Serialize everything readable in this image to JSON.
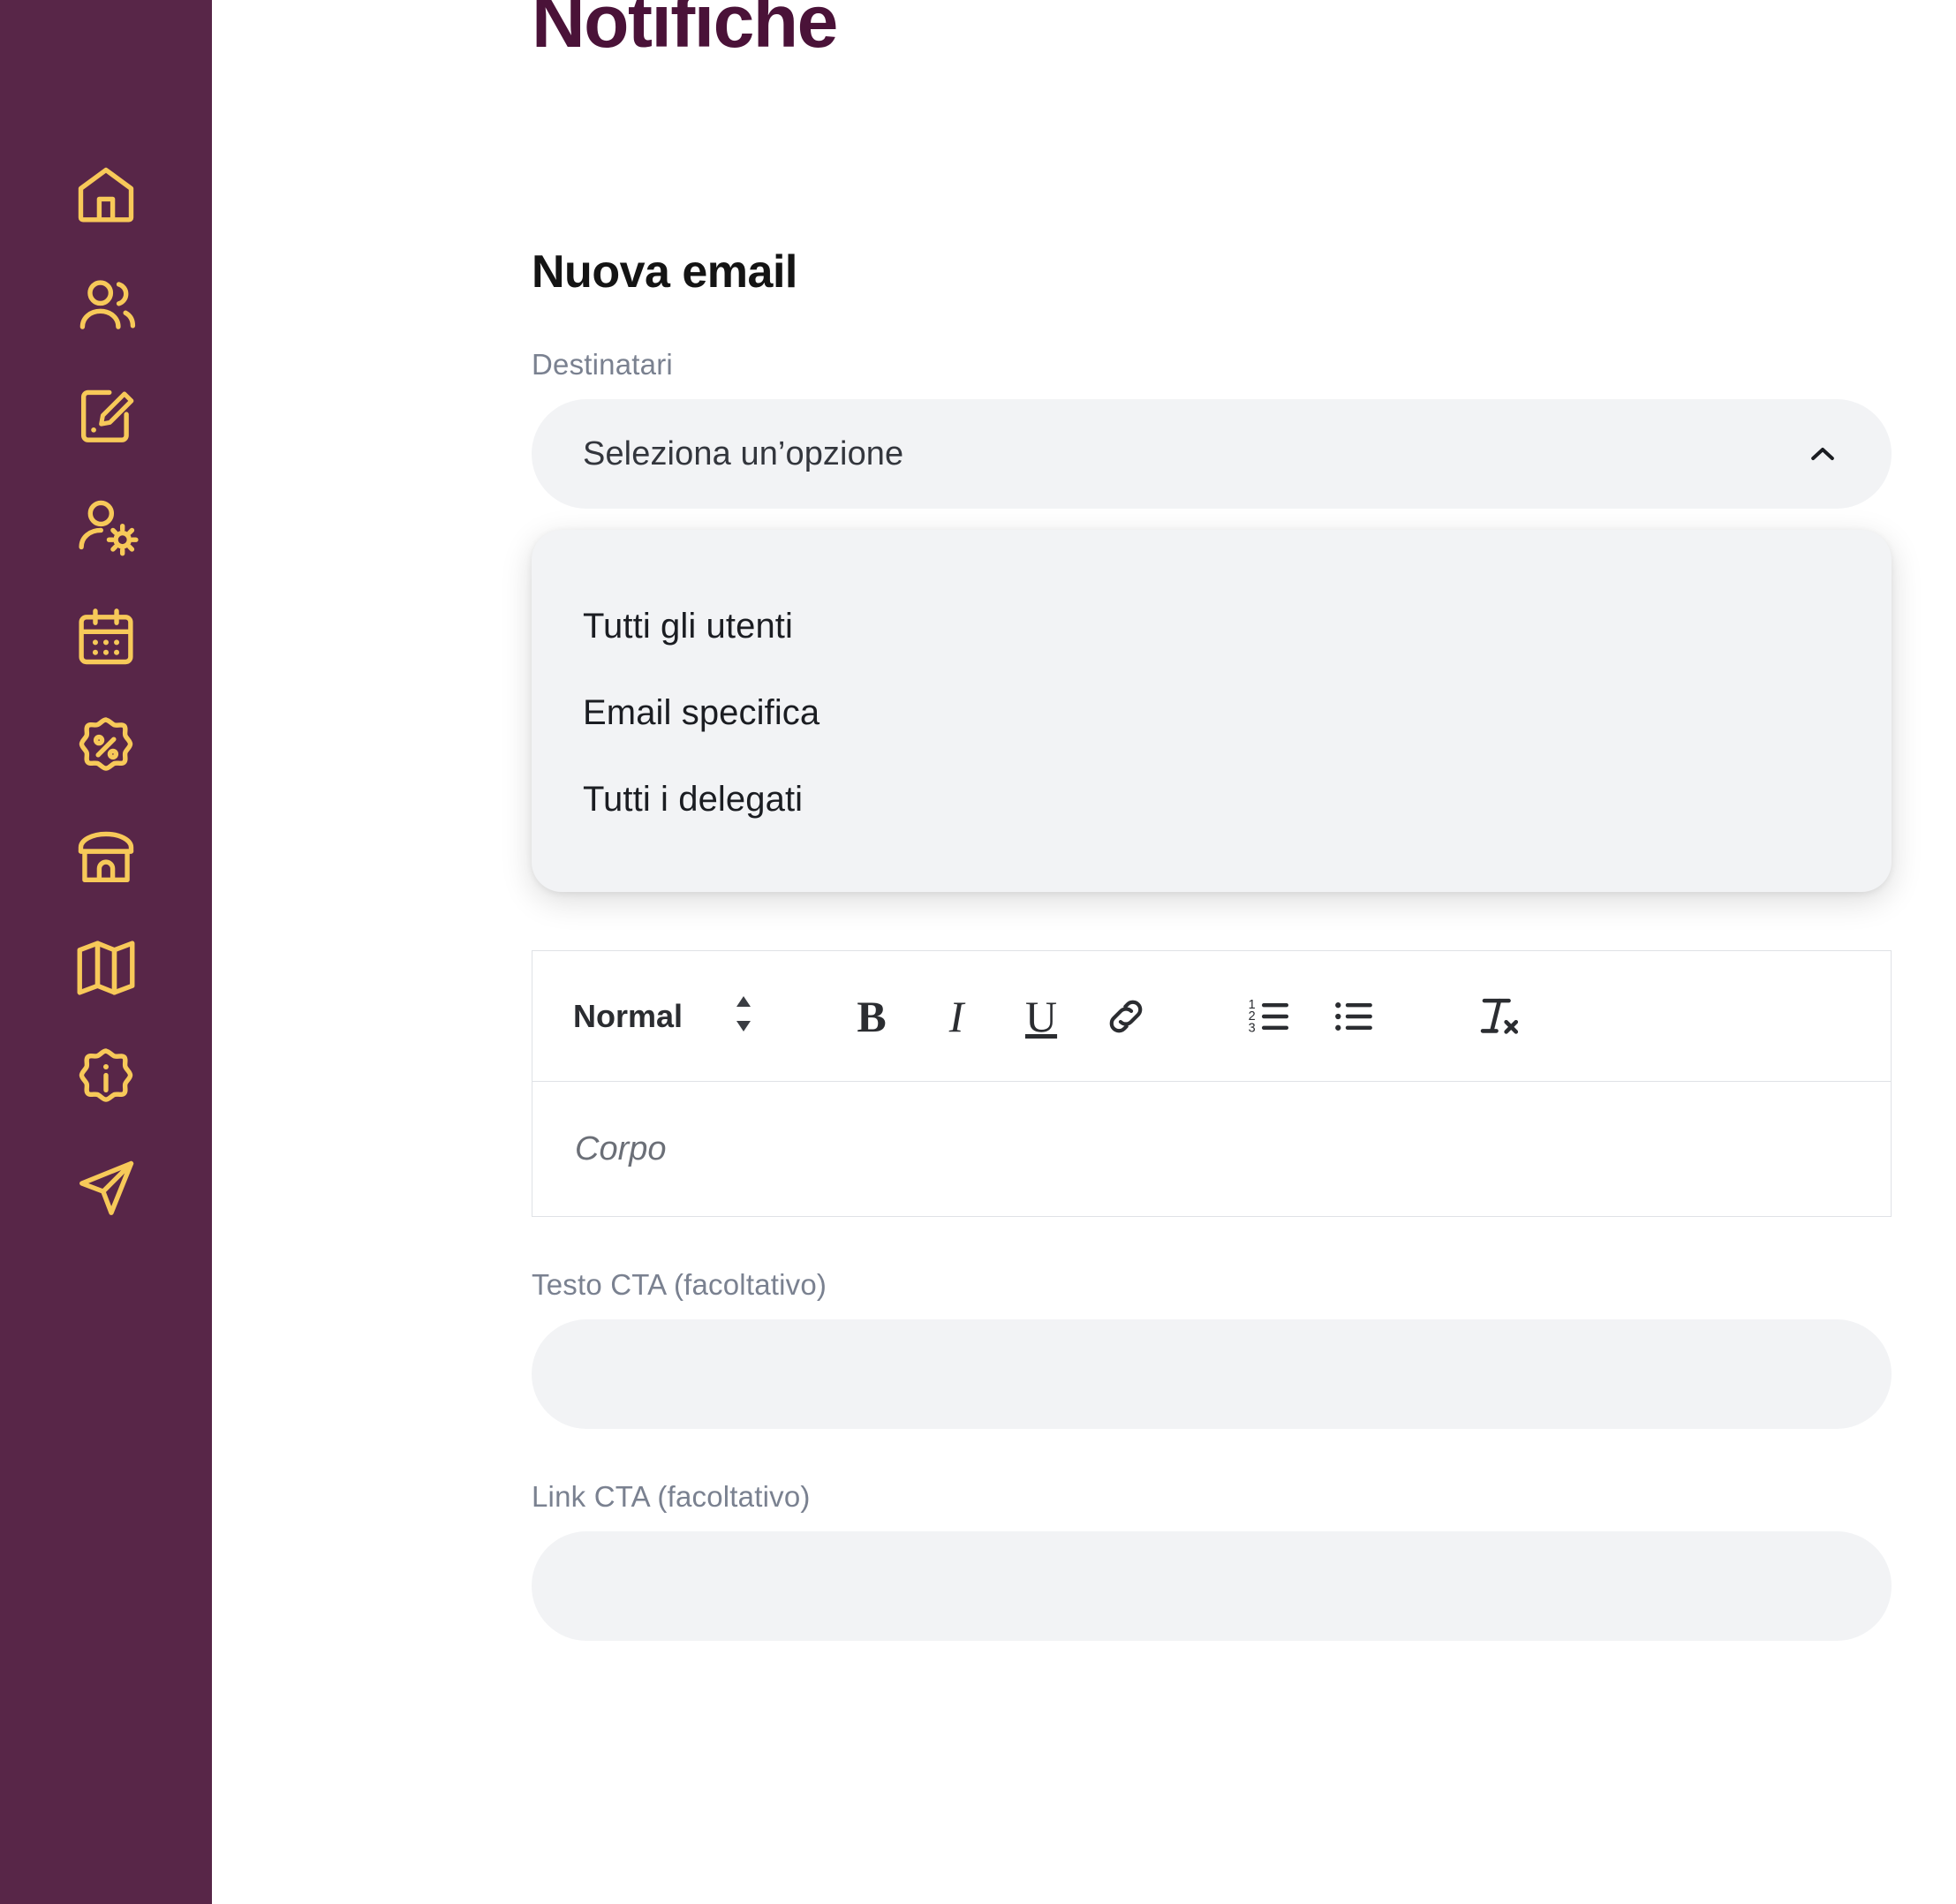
{
  "colors": {
    "sidebar_bg": "#582648",
    "sidebar_icon": "#F7C959",
    "title": "#4a1238",
    "field_bg": "#f2f3f5",
    "label": "#7a8190",
    "text": "#1b1d22"
  },
  "sidebar": {
    "items": [
      {
        "icon": "home-icon",
        "name": "sidebar-item-home"
      },
      {
        "icon": "users-icon",
        "name": "sidebar-item-users"
      },
      {
        "icon": "document-edit-icon",
        "name": "sidebar-item-documents"
      },
      {
        "icon": "user-settings-icon",
        "name": "sidebar-item-user-settings"
      },
      {
        "icon": "calendar-icon",
        "name": "sidebar-item-calendar"
      },
      {
        "icon": "discount-badge-icon",
        "name": "sidebar-item-promotions"
      },
      {
        "icon": "store-icon",
        "name": "sidebar-item-store"
      },
      {
        "icon": "map-icon",
        "name": "sidebar-item-map"
      },
      {
        "icon": "info-badge-icon",
        "name": "sidebar-item-info"
      },
      {
        "icon": "send-icon",
        "name": "sidebar-item-notifications"
      }
    ]
  },
  "header": {
    "title": "Notifiche"
  },
  "form": {
    "heading": "Nuova email",
    "recipients": {
      "label": "Destinatari",
      "selected_value": "Seleziona un’opzione",
      "expanded": true,
      "options": [
        "Tutti gli utenti",
        "Email specifica",
        "Tutti i delegati"
      ]
    },
    "editor": {
      "format_label": "Normal",
      "tools": [
        {
          "name": "bold-button",
          "label": "B"
        },
        {
          "name": "italic-button",
          "label": "I"
        },
        {
          "name": "underline-button",
          "label": "U"
        },
        {
          "name": "link-icon",
          "label": ""
        },
        {
          "name": "ordered-list-icon",
          "label": ""
        },
        {
          "name": "bullet-list-icon",
          "label": ""
        },
        {
          "name": "clear-format-icon",
          "label": ""
        }
      ],
      "body_placeholder": "Corpo"
    },
    "cta_text": {
      "label": "Testo CTA (facoltativo)",
      "value": "",
      "placeholder": ""
    },
    "cta_link": {
      "label": "Link CTA (facoltativo)",
      "value": "",
      "placeholder": ""
    }
  }
}
